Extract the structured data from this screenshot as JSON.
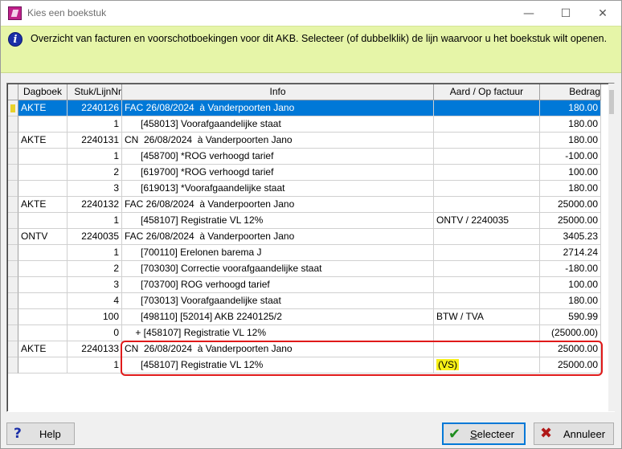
{
  "window": {
    "title": "Kies een boekstuk",
    "min_glyph": "—",
    "max_glyph": "☐",
    "close_glyph": "✕"
  },
  "banner": {
    "icon_glyph": "i",
    "text": "Overzicht van facturen en voorschotboekingen voor dit AKB. Selecteer (of dubbelklik) de lijn waarvoor u het boekstuk wilt openen."
  },
  "table": {
    "columns": [
      "Dagboek",
      "Stuk/LijnNr",
      "Info",
      "Aard / Op factuur",
      "Bedrag"
    ],
    "rows": [
      {
        "dagboek": "AKTE",
        "stuk": "2240126",
        "info": "FAC 26/08/2024  à Vanderpoorten Jano",
        "aard": "",
        "bedrag": "180.00"
      },
      {
        "dagboek": "",
        "stuk": "1",
        "info": "      [458013] Voorafgaandelijke staat",
        "aard": "",
        "bedrag": "180.00"
      },
      {
        "dagboek": "AKTE",
        "stuk": "2240131",
        "info": "CN  26/08/2024  à Vanderpoorten Jano",
        "aard": "",
        "bedrag": "180.00"
      },
      {
        "dagboek": "",
        "stuk": "1",
        "info": "      [458700] *ROG verhoogd tarief",
        "aard": "",
        "bedrag": "-100.00"
      },
      {
        "dagboek": "",
        "stuk": "2",
        "info": "      [619700] *ROG verhoogd tarief",
        "aard": "",
        "bedrag": "100.00"
      },
      {
        "dagboek": "",
        "stuk": "3",
        "info": "      [619013] *Voorafgaandelijke staat",
        "aard": "",
        "bedrag": "180.00"
      },
      {
        "dagboek": "AKTE",
        "stuk": "2240132",
        "info": "FAC 26/08/2024  à Vanderpoorten Jano",
        "aard": "",
        "bedrag": "25000.00"
      },
      {
        "dagboek": "",
        "stuk": "1",
        "info": "      [458107] Registratie VL 12%",
        "aard": "ONTV / 2240035",
        "bedrag": "25000.00"
      },
      {
        "dagboek": "ONTV",
        "stuk": "2240035",
        "info": "FAC 26/08/2024  à Vanderpoorten Jano",
        "aard": "",
        "bedrag": "3405.23"
      },
      {
        "dagboek": "",
        "stuk": "1",
        "info": "      [700110] Erelonen barema J",
        "aard": "",
        "bedrag": "2714.24"
      },
      {
        "dagboek": "",
        "stuk": "2",
        "info": "      [703030] Correctie voorafgaandelijke staat",
        "aard": "",
        "bedrag": "-180.00"
      },
      {
        "dagboek": "",
        "stuk": "3",
        "info": "      [703700] ROG verhoogd tarief",
        "aard": "",
        "bedrag": "100.00"
      },
      {
        "dagboek": "",
        "stuk": "4",
        "info": "      [703013] Voorafgaandelijke staat",
        "aard": "",
        "bedrag": "180.00"
      },
      {
        "dagboek": "",
        "stuk": "100",
        "info": "      [498110] [52014] AKB 2240125/2",
        "aard": "BTW / TVA",
        "bedrag": "590.99"
      },
      {
        "dagboek": "",
        "stuk": "0",
        "info": "    + [458107] Registratie VL 12%",
        "aard": "",
        "bedrag": "(25000.00)"
      },
      {
        "dagboek": "AKTE",
        "stuk": "2240133",
        "info": "CN  26/08/2024  à Vanderpoorten Jano",
        "aard": "",
        "bedrag": "25000.00"
      },
      {
        "dagboek": "",
        "stuk": "1",
        "info": "      [458107] Registratie VL 12%",
        "aard": "(VS)",
        "bedrag": "25000.00"
      }
    ]
  },
  "buttons": {
    "help": {
      "icon_glyph": "?",
      "label": "Help"
    },
    "select": {
      "icon_glyph": "✔",
      "label_first": "S",
      "label_rest": "electeer"
    },
    "cancel": {
      "icon_glyph": "✖",
      "label": "Annuleer"
    }
  },
  "colors": {
    "selection": "#0078d7",
    "banner": "#e6f5a8",
    "highlight_box": "#e01a1a",
    "highlight_text": "#f7f017"
  }
}
